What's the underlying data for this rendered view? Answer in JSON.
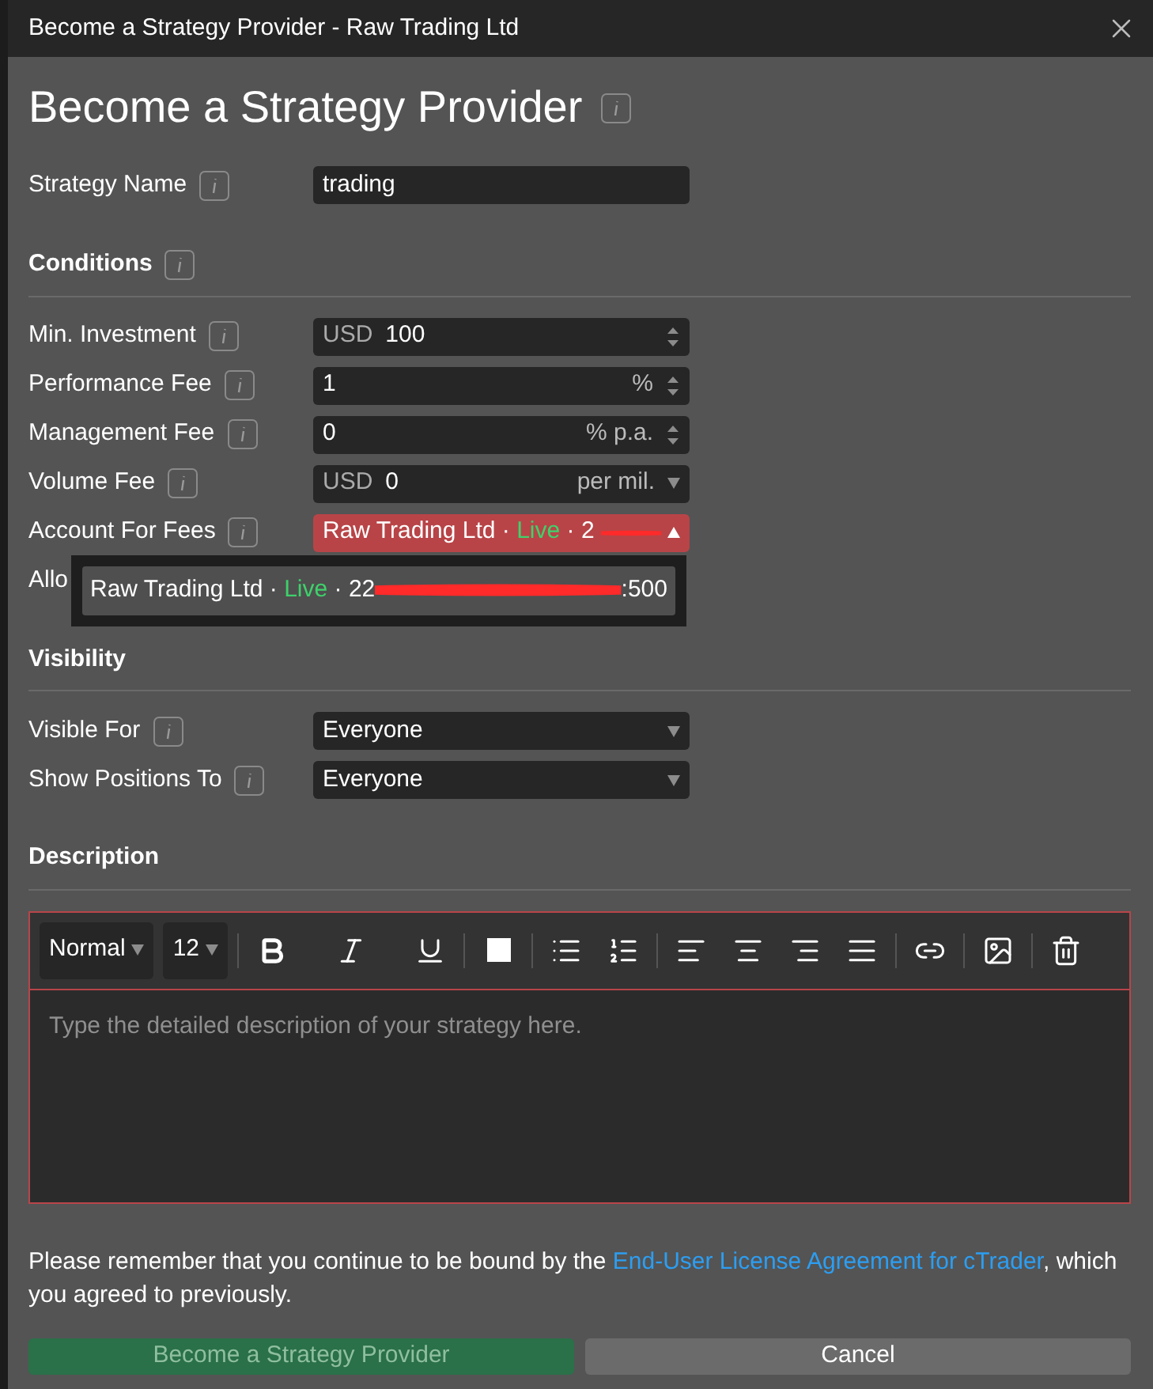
{
  "window": {
    "title": "Become a Strategy Provider - Raw Trading Ltd"
  },
  "heading": "Become a Strategy Provider",
  "strategy_name": {
    "label": "Strategy Name",
    "value": "trading"
  },
  "conditions": {
    "title": "Conditions",
    "fields": [
      {
        "kind": "spinner",
        "label": "Min. Investment",
        "prefix": "USD",
        "value": "100"
      },
      {
        "kind": "spinner",
        "label": "Performance Fee",
        "value": "1",
        "suffix": "%"
      },
      {
        "kind": "spinner",
        "label": "Management Fee",
        "value": "0",
        "suffix": "% p.a."
      },
      {
        "kind": "dropdown",
        "label": "Volume Fee",
        "prefix": "USD",
        "value": "0",
        "suffix": "per mil."
      },
      {
        "kind": "account",
        "label": "Account For Fees",
        "broker": "Raw Trading Ltd",
        "separator": "·",
        "type": "Live",
        "number": "2",
        "expanded": true
      },
      {
        "kind": "hidden",
        "label": "Allo"
      }
    ],
    "dropdown_option": {
      "broker": "Raw Trading Ltd",
      "separator": "·",
      "type": "Live",
      "number": "22",
      "tail": ":500"
    }
  },
  "visibility": {
    "title": "Visibility",
    "fields": [
      {
        "label": "Visible For",
        "value": "Everyone"
      },
      {
        "label": "Show Positions To",
        "value": "Everyone"
      }
    ]
  },
  "description": {
    "title": "Description",
    "style": "Normal",
    "size": "12",
    "placeholder": "Type the detailed description of your strategy here."
  },
  "notice": {
    "before": "Please remember that you continue to be bound by the ",
    "link": "End-User License Agreement for cTrader",
    "after": ", which you agreed to previously."
  },
  "buttons": [
    {
      "kind": "primary",
      "label": "Become a Strategy Provider",
      "disabled": true
    },
    {
      "kind": "secondary",
      "label": "Cancel",
      "disabled": false
    }
  ]
}
